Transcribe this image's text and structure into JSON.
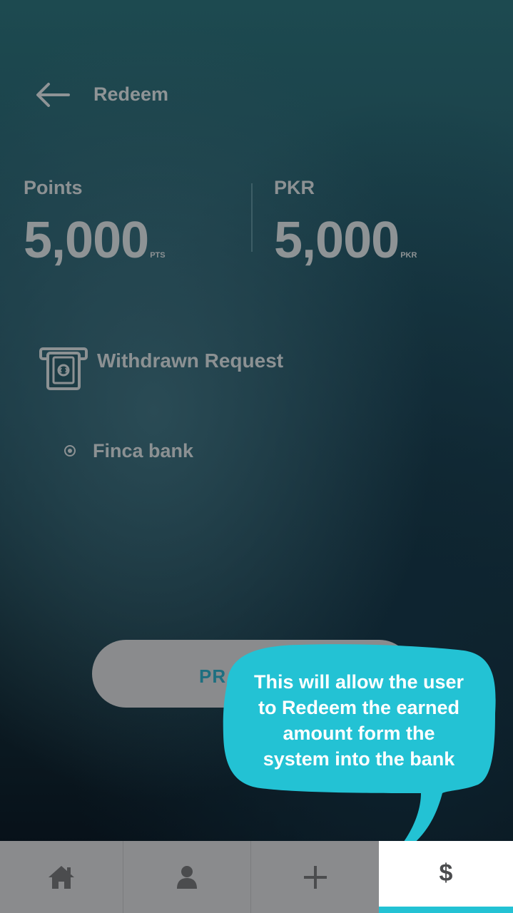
{
  "header": {
    "title": "Redeem",
    "back_icon": "arrow-left-icon"
  },
  "stats": {
    "points": {
      "label": "Points",
      "value": "5,000",
      "unit": "PTS"
    },
    "pkr": {
      "label": "PKR",
      "value": "5,000",
      "unit": "PKR"
    }
  },
  "withdraw": {
    "label": "Withdrawn Request",
    "icon": "atm-cash-icon"
  },
  "bank_option": {
    "label": "Finca bank",
    "selected": true
  },
  "proceed_button": {
    "label": "PROCEED",
    "visible_fragment": "PR"
  },
  "annotation": {
    "lines": [
      "This will allow the user",
      "to Redeem the earned",
      "amount form the",
      "system into the bank"
    ],
    "color": "#23c2d4"
  },
  "tabbar": {
    "tabs": [
      {
        "name": "home",
        "icon": "home-icon"
      },
      {
        "name": "profile",
        "icon": "user-icon"
      },
      {
        "name": "add",
        "icon": "plus-icon"
      },
      {
        "name": "redeem",
        "icon": "dollar-icon",
        "glyph": "$",
        "active": true
      }
    ],
    "active_color": "#23c2d4"
  }
}
